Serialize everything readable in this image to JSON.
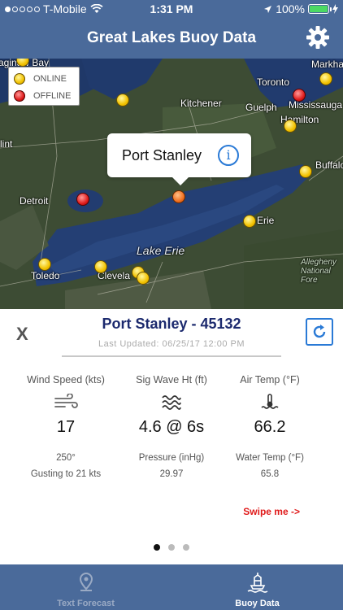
{
  "status_bar": {
    "carrier": "T-Mobile",
    "time": "1:31 PM",
    "battery": "100%",
    "battery_level": 1.0
  },
  "header": {
    "title": "Great Lakes Buoy Data",
    "settings_icon": "gear-icon"
  },
  "map": {
    "legend": {
      "online": "ONLINE",
      "offline": "OFFLINE"
    },
    "labels": {
      "saginaw_bay": "aginaw Bay",
      "markham": "Markha",
      "toronto": "Toronto",
      "kitchener": "Kitchener",
      "guelph": "Guelph",
      "mississauga": "Mississauga",
      "hamilton": "Hamilton",
      "flint": "lint",
      "buffalo": "Buffalo",
      "detroit": "Detroit",
      "erie": "Erie",
      "lake_erie": "Lake Erie",
      "toledo": "Toledo",
      "cleveland": "Clevela",
      "allegheny": "Allegheny National Fore"
    },
    "callout": {
      "station_name": "Port Stanley",
      "info_icon": "info-icon"
    }
  },
  "detail": {
    "close_label": "X",
    "station_title": "Port Stanley - 45132",
    "last_updated": "Last Updated: 06/25/17 12:00 PM",
    "refresh_icon": "refresh-icon",
    "wind": {
      "header": "Wind Speed (kts)",
      "value": "17",
      "direction": "250°",
      "gust": "Gusting to 21 kts"
    },
    "wave": {
      "header": "Sig Wave Ht (ft)",
      "value": "4.6 @ 6s",
      "pressure_label": "Pressure (inHg)",
      "pressure_value": "29.97"
    },
    "air": {
      "header": "Air Temp (°F)",
      "value": "66.2",
      "water_label": "Water Temp (°F)",
      "water_value": "65.8"
    },
    "swipe_hint": "Swipe me ->",
    "pages": 3,
    "active_page": 1
  },
  "tabs": [
    {
      "label": "Text Forecast",
      "icon": "location-pin-icon",
      "active": false
    },
    {
      "label": "Buoy Data",
      "icon": "buoy-icon",
      "active": true
    }
  ],
  "colors": {
    "header_bg": "#4a6a9a",
    "station_title": "#1c2a6e",
    "accent_blue": "#2a7ad6",
    "swipe_red": "#e01a1a",
    "online_pin": "#f2c200",
    "offline_pin": "#e01e1e",
    "selected_pin": "#f07020",
    "inactive_tab": "#9aaac4"
  }
}
